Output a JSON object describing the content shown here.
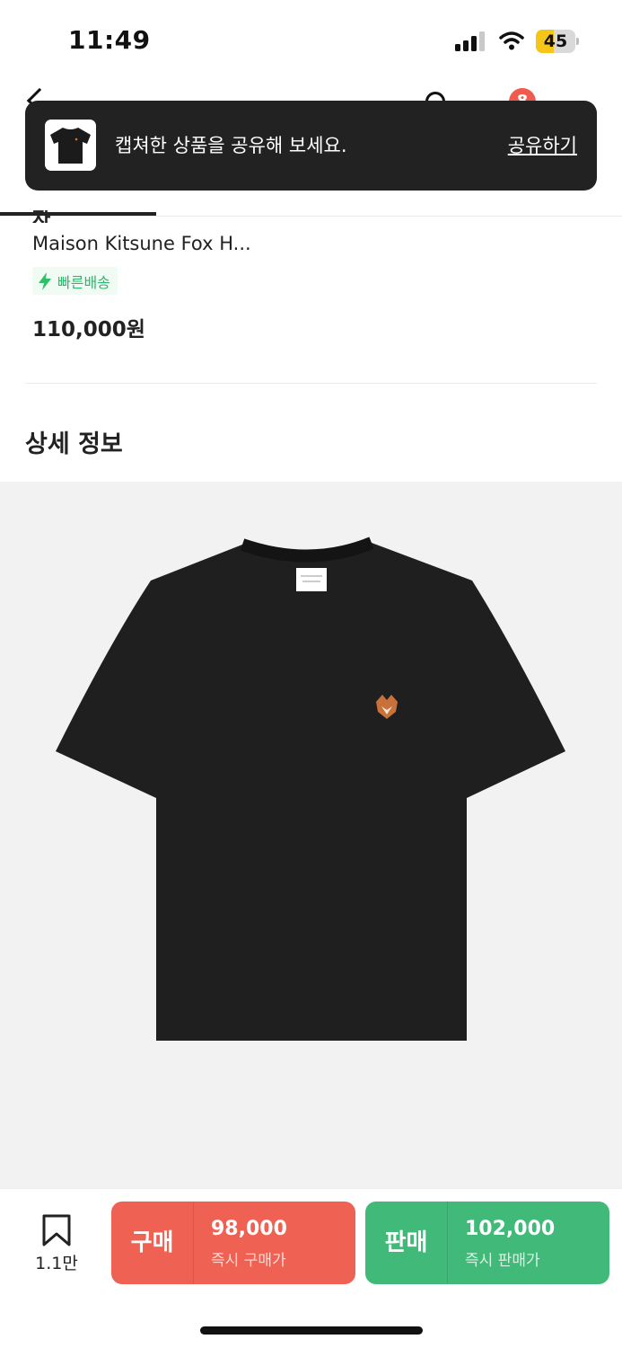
{
  "status": {
    "time": "11:49",
    "battery": "45",
    "battery_level": 0.45
  },
  "nav": {
    "cart_count": "8"
  },
  "toast": {
    "message": "캡쳐한 상품을 공유해 보세요.",
    "action": "공유하기"
  },
  "product": {
    "partial_title": "자",
    "name": "Maison Kitsune Fox H...",
    "badge": "빠른배송",
    "price": "110,000원"
  },
  "section": {
    "title": "상세 정보"
  },
  "bottom": {
    "wish_count": "1.1만",
    "buy": {
      "label": "구매",
      "price": "98,000",
      "sub": "즉시 구매가"
    },
    "sell": {
      "label": "판매",
      "price": "102,000",
      "sub": "즉시 판매가"
    }
  },
  "colors": {
    "buy": "#ef6253",
    "sell": "#41b979",
    "toast_bg": "#222222",
    "fast_badge": "#31b46e",
    "badge": "#ef5b4f"
  }
}
